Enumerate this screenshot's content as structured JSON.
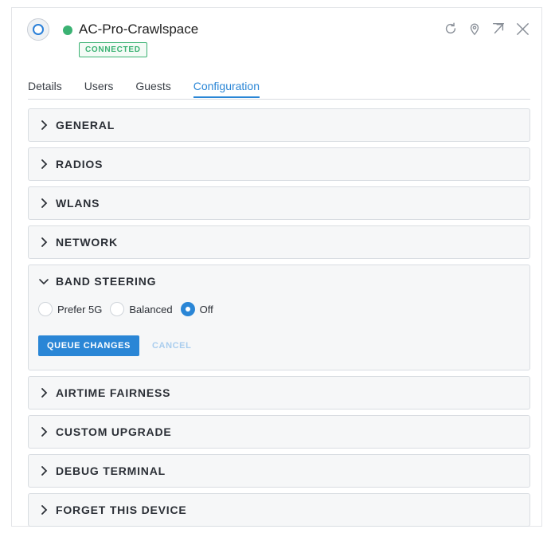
{
  "device": {
    "name": "AC-Pro-Crawlspace",
    "status": "CONNECTED",
    "status_color": "#3bb273"
  },
  "header_actions": [
    {
      "icon": "refresh-icon"
    },
    {
      "icon": "locate-icon"
    },
    {
      "icon": "popout-icon"
    },
    {
      "icon": "close-icon"
    }
  ],
  "tabs": [
    {
      "label": "Details",
      "active": false
    },
    {
      "label": "Users",
      "active": false
    },
    {
      "label": "Guests",
      "active": false
    },
    {
      "label": "Configuration",
      "active": true
    }
  ],
  "sections": {
    "general": "GENERAL",
    "radios": "RADIOS",
    "wlans": "WLANS",
    "network": "NETWORK",
    "band_steering": "BAND STEERING",
    "airtime_fairness": "AIRTIME FAIRNESS",
    "custom_upgrade": "CUSTOM UPGRADE",
    "debug_terminal": "DEBUG TERMINAL",
    "forget_device": "FORGET THIS DEVICE"
  },
  "band_steering": {
    "options": [
      "Prefer 5G",
      "Balanced",
      "Off"
    ],
    "selected": "Off",
    "queue_label": "QUEUE CHANGES",
    "cancel_label": "CANCEL"
  },
  "colors": {
    "accent": "#2a86d6",
    "connected": "#3bb273"
  }
}
